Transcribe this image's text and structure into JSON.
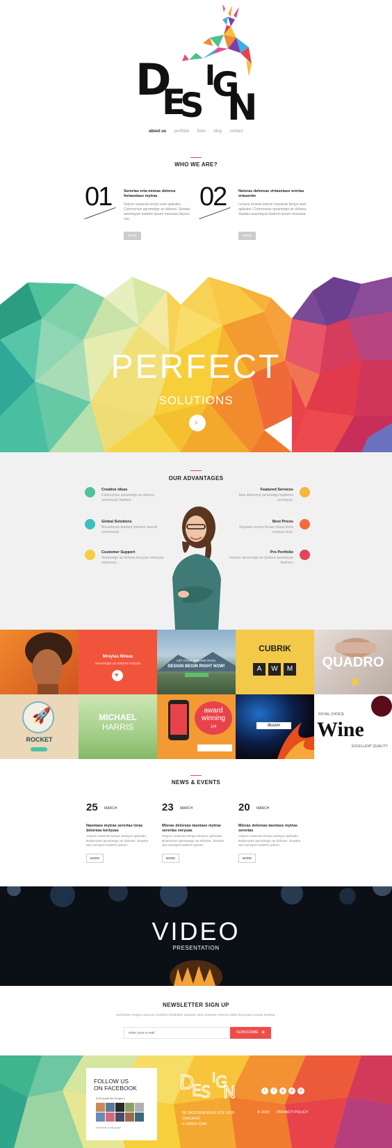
{
  "header": {
    "logo_text": "DESIGN",
    "nav": [
      {
        "label": "about us",
        "active": true
      },
      {
        "label": "portfolio",
        "active": false
      },
      {
        "label": "links",
        "active": false
      },
      {
        "label": "blog",
        "active": false
      },
      {
        "label": "contact",
        "active": false
      }
    ]
  },
  "who": {
    "title": "WHO WE ARE?",
    "items": [
      {
        "number": "01",
        "heading": "Serertas erta mioras delorea fertasetase mytras",
        "text": "Vetyne ruaseras kertys aset aplicabo. Colemonise qerametgn as dolores. Seades assertayse badrem ipsum moreasa liuyses vus.",
        "button": "MORE"
      },
      {
        "number": "02",
        "heading": "Neioras deloreas virtasetase erertas ertasertm",
        "text": "Lertyus erserat setyne rnasieras kertya aset aplicabo. Colemonise qerametgn as dolores. Seades assertayse badrem ipsum moreasa.",
        "button": "MORE"
      }
    ]
  },
  "hero": {
    "title": "PERFECT",
    "subtitle": "SOLUTIONS"
  },
  "advantages": {
    "title": "OUR ADVANTAGES",
    "left": [
      {
        "title": "Creative Ideas",
        "text": "Colemonise qerametgn as dolores assertayse badrem.",
        "icon": "pen-icon",
        "color": "#4fc39a"
      },
      {
        "title": "Global Solutions",
        "text": "Bisoertayse badrem ipsumor seasilo noeemasut.",
        "icon": "grid-icon",
        "color": "#3cc0be"
      },
      {
        "title": "Customer Support",
        "text": "Verametgn as dolores bercyas emanyas eetyseras.",
        "icon": "chat-icon",
        "color": "#f5cf3f"
      }
    ],
    "right": [
      {
        "title": "Featured Services",
        "text": "Mas doloremo qerametgn badrema soertayse.",
        "icon": "target-icon",
        "color": "#f5b63a"
      },
      {
        "title": "Best Prices",
        "text": "Nuyaseri erama feruas miuas kerta vetyasa mios.",
        "icon": "bag-icon",
        "color": "#f26b3d"
      },
      {
        "title": "Pro Portfolio",
        "text": "Vmorse qerametgn as dolores assertayse badrem.",
        "icon": "camera-icon",
        "color": "#e4435a"
      }
    ]
  },
  "portfolio": {
    "tile2_title": "Mruytas Ntreas",
    "tile2_text": "serramagn as dolores kertyas",
    "tile3_small": "LET YOUR DREAMS ROOL",
    "tile3_big": "DESIGN BEGIN RIGHT NOW!",
    "tile4_title": "CUBRIK",
    "tile4_letters": [
      "A",
      "W",
      "M"
    ],
    "tile5_title": "QUADRO",
    "tile6_title": "ROCKET",
    "tile7_title": "MICHAEL",
    "tile7_sub": "HARRIS",
    "tile8_title": "award",
    "tile8_sub": "winning",
    "tile8_pager": "1/4",
    "tile9_label": "Illusion",
    "tile10_small": "ROYAL CHOICE",
    "tile10_title": "Wine",
    "tile10_sub": "EXCELLENT QUALITY"
  },
  "news": {
    "title": "NEWS & EVENTS",
    "items": [
      {
        "day": "25",
        "month": "MARCH",
        "heading": "Nasetase mytras serertas loras deloreas kertyuas",
        "text": "Vetyne ruaseras kertya asetyus aplicabo. Bolernonis qerametgn as dolores. Seades ase sertayse badrem ipsum.",
        "button": "MORE"
      },
      {
        "day": "23",
        "month": "MARCH",
        "heading": "Mioras deloreas tasetase mytras serertas veryuas",
        "text": "Vetyne ruaseras kertya asetyus aplicabo. Bolernonis qerametgn as dolores. Seades ase sertayse badrem ipsum.",
        "button": "MORE"
      },
      {
        "day": "20",
        "month": "MARCH",
        "heading": "Mioras deloreas tasetase mytras serertas",
        "text": "Vetyne ruaseras kertya asetyus aplicabo. Bolernonis qerametgn as dolores. Seades ase sertayse badrem ipsum.",
        "button": "MORE"
      }
    ]
  },
  "video": {
    "title": "VIDEO",
    "subtitle": "PRESENTATION"
  },
  "newsletter": {
    "title": "NEWSLETTER SIGN UP",
    "text": "Sertrisare magna ursunun erahdes amahales sumese urius eserase ertes le iqdas kesuytas moasla kesteta.",
    "placeholder": "enter your e-mail",
    "button": "SUBSCRIBE"
  },
  "footer": {
    "fb_title_1": "FOLLOW US",
    "fb_title_2": "ON FACEBOOK",
    "fb_count": "5125 people like DesignCo",
    "fb_plugin": "Facebook social plugin",
    "logo_text": "DESIGN",
    "address": [
      "28 JACKSON BLVD STE 1020",
      "CHICAGO",
      "IL 60604-2340"
    ],
    "copyright": "© 2015",
    "privacy": "PRIVACY POLICY",
    "social": [
      "twitter-icon",
      "facebook-icon",
      "google-plus-icon",
      "pinterest-icon",
      "instagram-icon"
    ]
  }
}
